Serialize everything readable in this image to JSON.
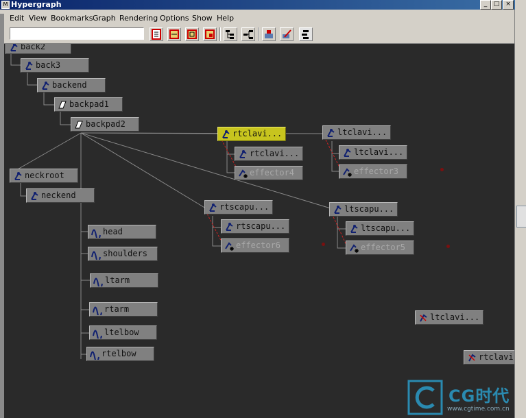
{
  "window": {
    "title": "Hypergraph",
    "min": "_",
    "max": "□",
    "close": "×"
  },
  "menu": [
    "Edit",
    "View",
    "Bookmarks",
    "Graph",
    "Rendering",
    "Options",
    "Show",
    "Help"
  ],
  "toolbar": {
    "address_value": ""
  },
  "nodes": [
    {
      "id": "back2",
      "label": "back2",
      "type": "joint"
    },
    {
      "id": "back3",
      "label": "back3",
      "type": "joint"
    },
    {
      "id": "backend",
      "label": "backend",
      "type": "joint"
    },
    {
      "id": "backpad1",
      "label": "backpad1",
      "type": "pad"
    },
    {
      "id": "backpad2",
      "label": "backpad2",
      "type": "pad"
    },
    {
      "id": "rtclavi1",
      "label": "rtclavi...",
      "type": "joint",
      "selected": true
    },
    {
      "id": "rtclavi2",
      "label": "rtclavi...",
      "type": "joint"
    },
    {
      "id": "effector4",
      "label": "effector4",
      "type": "effector"
    },
    {
      "id": "ltclavi1",
      "label": "ltclavi...",
      "type": "joint"
    },
    {
      "id": "ltclavi2",
      "label": "ltclavi...",
      "type": "joint"
    },
    {
      "id": "effector3",
      "label": "effector3",
      "type": "effector"
    },
    {
      "id": "neckroot",
      "label": "neckroot",
      "type": "joint"
    },
    {
      "id": "neckend",
      "label": "neckend",
      "type": "joint"
    },
    {
      "id": "rtscapu1",
      "label": "rtscapu...",
      "type": "joint"
    },
    {
      "id": "rtscapu2",
      "label": "rtscapu...",
      "type": "joint"
    },
    {
      "id": "effector6",
      "label": "effector6",
      "type": "effector"
    },
    {
      "id": "ltscapu1",
      "label": "ltscapu...",
      "type": "joint"
    },
    {
      "id": "ltscapu2",
      "label": "ltscapu...",
      "type": "joint"
    },
    {
      "id": "effector5",
      "label": "effector5",
      "type": "effector"
    },
    {
      "id": "head",
      "label": "head",
      "type": "curve"
    },
    {
      "id": "shoulders",
      "label": "shoulders",
      "type": "curve"
    },
    {
      "id": "ltarm",
      "label": "ltarm",
      "type": "curve"
    },
    {
      "id": "rtarm",
      "label": "rtarm",
      "type": "curve"
    },
    {
      "id": "ltelbow",
      "label": "ltelbow",
      "type": "curve"
    },
    {
      "id": "rtelbow",
      "label": "rtelbow",
      "type": "curve"
    },
    {
      "id": "ltclavi_ik",
      "label": "ltclavi...",
      "type": "ikhandle"
    },
    {
      "id": "rtclavi_ik",
      "label": "rtclavi",
      "type": "ikhandle"
    }
  ],
  "watermark": {
    "brand": "CG时代",
    "url": "www.cgtime.com.cn"
  },
  "colors": {
    "graph_bg": "#2a2a2a",
    "node": "#808080",
    "selected": "#c7c41e",
    "edge": "#8a8a8a",
    "ik_edge": "#cc2222"
  }
}
